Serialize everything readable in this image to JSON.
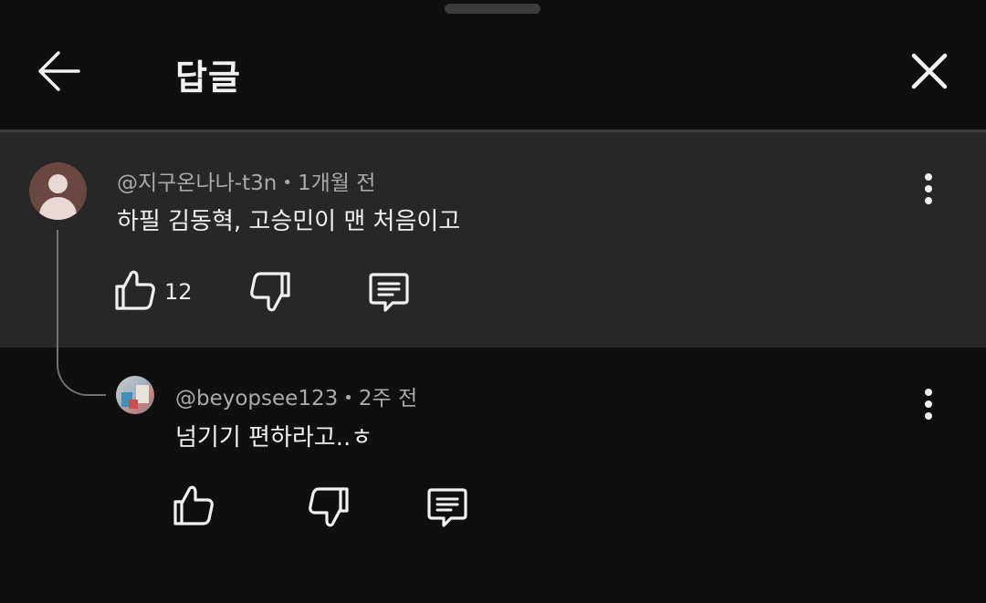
{
  "header": {
    "title": "답글",
    "back_icon": "arrow-left-icon",
    "close_icon": "close-icon"
  },
  "parent_comment": {
    "author": "@지구온나나-t3n",
    "separator": "•",
    "time": "1개월 전",
    "text": "하필 김동혁, 고승민이 맨 처음이고",
    "like_count": "12",
    "icons": [
      "thumbs-up-icon",
      "thumbs-down-icon",
      "reply-icon",
      "more-vertical-icon"
    ]
  },
  "reply_comment": {
    "author": "@beyopsee123",
    "separator": "•",
    "time": "2주 전",
    "text": "넘기기 편하라고..ㅎ",
    "icons": [
      "thumbs-up-icon",
      "thumbs-down-icon",
      "reply-icon",
      "more-vertical-icon"
    ]
  },
  "colors": {
    "background": "#0f0f0f",
    "highlight_background": "#272727",
    "text_primary": "#f1f1f1",
    "text_secondary": "#aaaaaa"
  }
}
